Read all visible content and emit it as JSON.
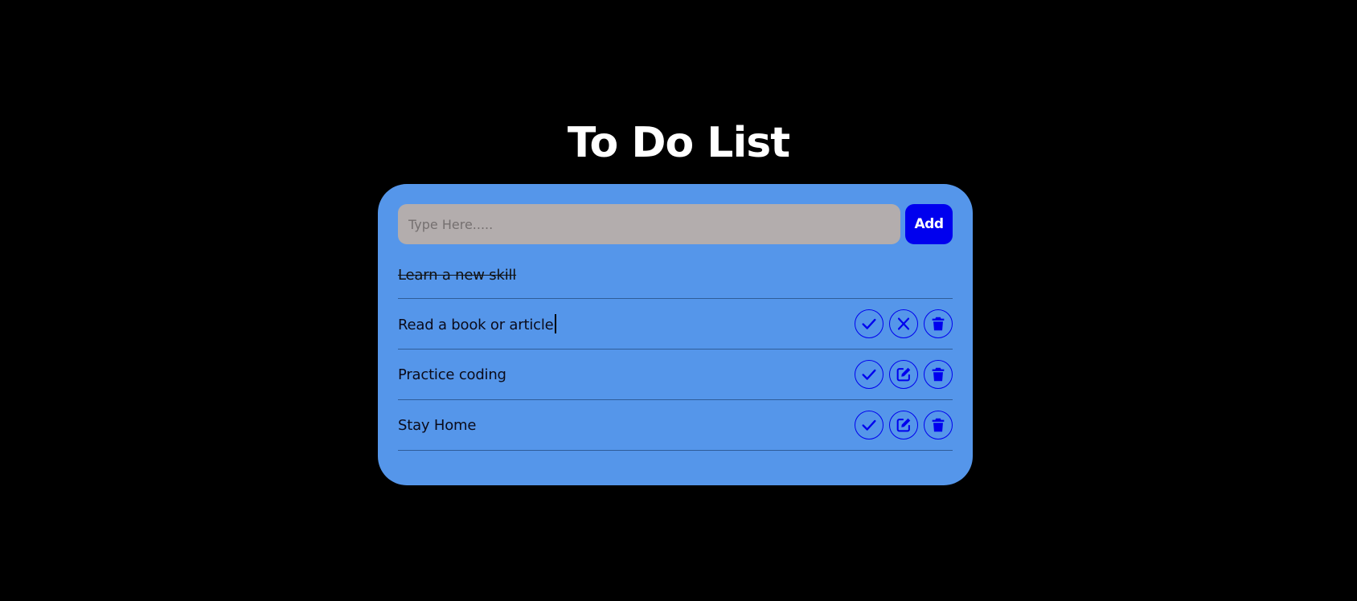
{
  "app": {
    "title": "To Do List"
  },
  "input": {
    "placeholder": "Type Here.....",
    "value": "",
    "add_label": "Add"
  },
  "colors": {
    "background": "#000000",
    "card": "#5596ea",
    "accent": "#0000ee",
    "input_bg": "#b3adad"
  },
  "tasks": [
    {
      "text": "Learn a new skill",
      "completed": true,
      "editing": false,
      "actions": []
    },
    {
      "text": "Read a book or article",
      "completed": false,
      "editing": true,
      "actions": [
        "check-icon",
        "cancel-icon",
        "trash-icon"
      ]
    },
    {
      "text": "Practice coding",
      "completed": false,
      "editing": false,
      "actions": [
        "check-icon",
        "edit-icon",
        "trash-icon"
      ]
    },
    {
      "text": "Stay Home",
      "completed": false,
      "editing": false,
      "actions": [
        "check-icon",
        "edit-icon",
        "trash-icon"
      ]
    }
  ]
}
